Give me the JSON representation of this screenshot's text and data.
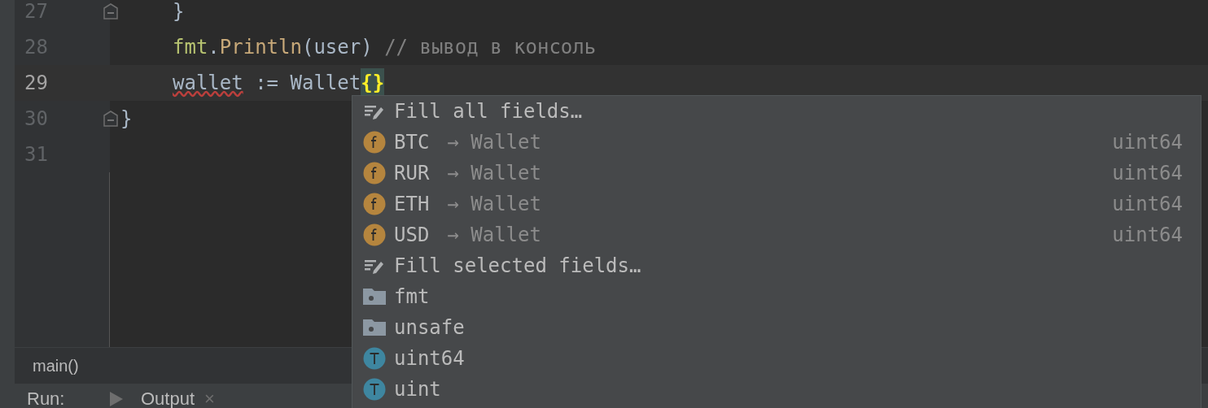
{
  "editor": {
    "lines": [
      {
        "children": [
          {
            "number": "27",
            "current": false,
            "fold": true,
            "tokens": [
              {
                "kind": "plain",
                "text": "}"
              }
            ]
          },
          {
            "number": "28",
            "current": false,
            "fold": false,
            "tokens": [
              {
                "kind": "func",
                "text": "fmt"
              },
              {
                "kind": "plain",
                "text": "."
              },
              {
                "kind": "method",
                "text": "Println"
              },
              {
                "kind": "plain",
                "text": "(user) "
              },
              {
                "kind": "comment",
                "text": "// вывод в консоль"
              }
            ]
          },
          {
            "number": "29",
            "current": true,
            "fold": false,
            "tokens": [
              {
                "kind": "error",
                "text": "wallet"
              },
              {
                "kind": "plain",
                "text": " := Wallet"
              },
              {
                "kind": "brace",
                "text": "{"
              },
              {
                "kind": "brace",
                "text": "}"
              }
            ]
          }
        ]
      },
      {
        "number": "30",
        "current": false,
        "fold": true,
        "tokens": [
          {
            "kind": "plain",
            "text": "}"
          }
        ]
      },
      {
        "number": "31",
        "current": false,
        "fold": false
      }
    ]
  },
  "completion": {
    "items": [
      {
        "kind": "action",
        "label": "Fill all fields…"
      },
      {
        "kind": "field",
        "label": "BTC",
        "hint": "→ Wallet",
        "type": "uint64"
      },
      {
        "kind": "field",
        "label": "RUR",
        "hint": "→ Wallet",
        "type": "uint64"
      },
      {
        "kind": "field",
        "label": "ETH",
        "hint": "→ Wallet",
        "type": "uint64"
      },
      {
        "kind": "field",
        "label": "USD",
        "hint": "→ Wallet",
        "type": "uint64"
      },
      {
        "kind": "action",
        "label": "Fill selected fields…"
      },
      {
        "kind": "package",
        "label": "fmt"
      },
      {
        "kind": "package",
        "label": "unsafe"
      },
      {
        "kind": "type",
        "label": "uint64"
      },
      {
        "kind": "type",
        "label": "uint"
      }
    ]
  },
  "breadcrumb": {
    "label": "main()"
  },
  "run_bar": {
    "label": "Run:",
    "tab": "Output",
    "close": "×"
  }
}
